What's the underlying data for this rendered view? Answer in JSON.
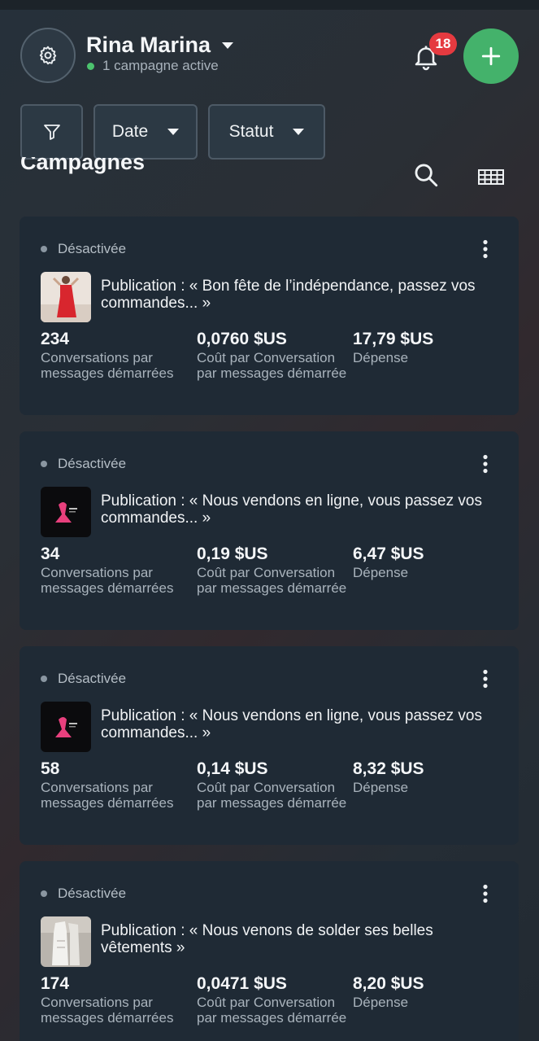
{
  "header": {
    "account_name": "Rina Marina",
    "account_status": "1 campagne active",
    "notification_count": "18"
  },
  "filters": {
    "date_label": "Date",
    "status_label": "Statut"
  },
  "section": {
    "title": "Campagnes"
  },
  "campaigns": [
    {
      "status": "Désactivée",
      "title": "Publication : « Bon fête de l’indépendance, passez vos commandes... »",
      "thumb": "red-dress-photo",
      "metric1_value": "234",
      "metric1_label": "Conversations par messages démarrées",
      "metric2_value": "0,0760 $US",
      "metric2_label": "Coût par Conversation par messages démarrée",
      "metric3_value": "17,79 $US",
      "metric3_label": "Dépense"
    },
    {
      "status": "Désactivée",
      "title": "Publication : « Nous vendons en ligne, vous passez vos commandes... »",
      "thumb": "pink-logo-black",
      "metric1_value": "34",
      "metric1_label": "Conversations par messages démarrées",
      "metric2_value": "0,19 $US",
      "metric2_label": "Coût par Conversation par messages démarrée",
      "metric3_value": "6,47 $US",
      "metric3_label": "Dépense"
    },
    {
      "status": "Désactivée",
      "title": "Publication : « Nous vendons en ligne, vous passez vos commandes... »",
      "thumb": "pink-logo-black",
      "metric1_value": "58",
      "metric1_label": "Conversations par messages démarrées",
      "metric2_value": "0,14 $US",
      "metric2_label": "Coût par Conversation par messages démarrée",
      "metric3_value": "8,32 $US",
      "metric3_label": "Dépense"
    },
    {
      "status": "Désactivée",
      "title": "Publication : « Nous venons de solder ses belles vêtements »",
      "thumb": "white-outfit-photo",
      "metric1_value": "174",
      "metric1_label": "Conversations par messages démarrées",
      "metric2_value": "0,0471 $US",
      "metric2_label": "Coût par Conversation par messages démarrée",
      "metric3_value": "8,20 $US",
      "metric3_label": "Dépense"
    }
  ],
  "colors": {
    "accent_green": "#44b26b",
    "badge_red": "#e53a40",
    "card_bg": "#1f2a35"
  }
}
